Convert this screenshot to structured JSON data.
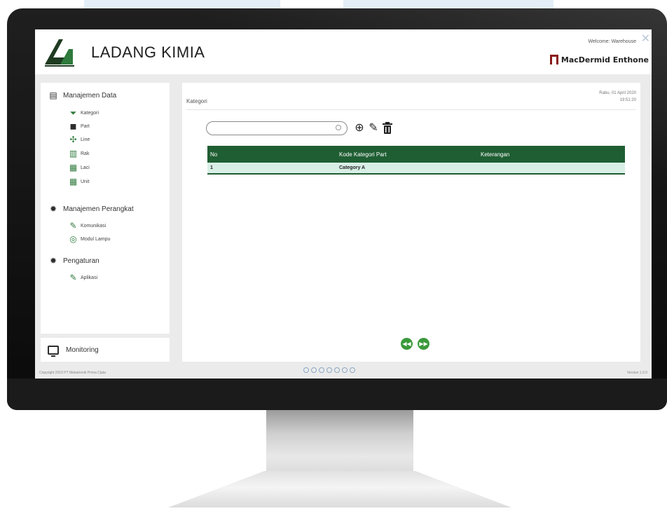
{
  "header": {
    "app_title": "LADANG KIMIA",
    "welcome": "Welcome: Warehouse",
    "brand": "MacDermid Enthone",
    "close_icon": "close-icon"
  },
  "sidebar": {
    "sections": [
      {
        "label": "Manajemen Data",
        "icon": "database-icon",
        "items": [
          {
            "label": "Kategori",
            "icon": "filter-icon"
          },
          {
            "label": "Part",
            "icon": "cube-icon"
          },
          {
            "label": "Line",
            "icon": "network-icon"
          },
          {
            "label": "Rak",
            "icon": "rack-icon"
          },
          {
            "label": "Laci",
            "icon": "drawer-icon"
          },
          {
            "label": "Unit",
            "icon": "unit-icon"
          }
        ]
      },
      {
        "label": "Manajemen Perangkat",
        "icon": "gear-icon",
        "items": [
          {
            "label": "Komunikasi",
            "icon": "feather-icon"
          },
          {
            "label": "Modul Lampu",
            "icon": "lamp-module-icon"
          }
        ]
      },
      {
        "label": "Pengaturan",
        "icon": "gear-icon",
        "items": [
          {
            "label": "Aplikasi",
            "icon": "feather-icon"
          }
        ]
      }
    ],
    "monitoring": "Monitoring"
  },
  "main": {
    "breadcrumb": "Kategori",
    "date_line1": "Rabu, 01 April 2020",
    "date_line2": "19:51:20",
    "search": {
      "value": "",
      "placeholder": ""
    },
    "toolbar": {
      "add": "add-icon",
      "edit": "pencil-icon",
      "delete": "trash-icon"
    },
    "table": {
      "columns": [
        "No",
        "Kode Kategori Part",
        "Keterangan"
      ],
      "rows": [
        [
          "1",
          "Category A",
          ""
        ]
      ]
    },
    "pager": {
      "prev": "rewind-icon",
      "next": "fast-forward-icon"
    }
  },
  "footer": {
    "copyright": "Copyright 2019 PT Mekatronik Prima Cipta",
    "version": "Version 1.0.0"
  },
  "colors": {
    "accent_green": "#1f5e33",
    "row_highlight": "#d8efe6",
    "pager_green": "#3a9a3a",
    "brand_red": "#8a1a1a"
  }
}
